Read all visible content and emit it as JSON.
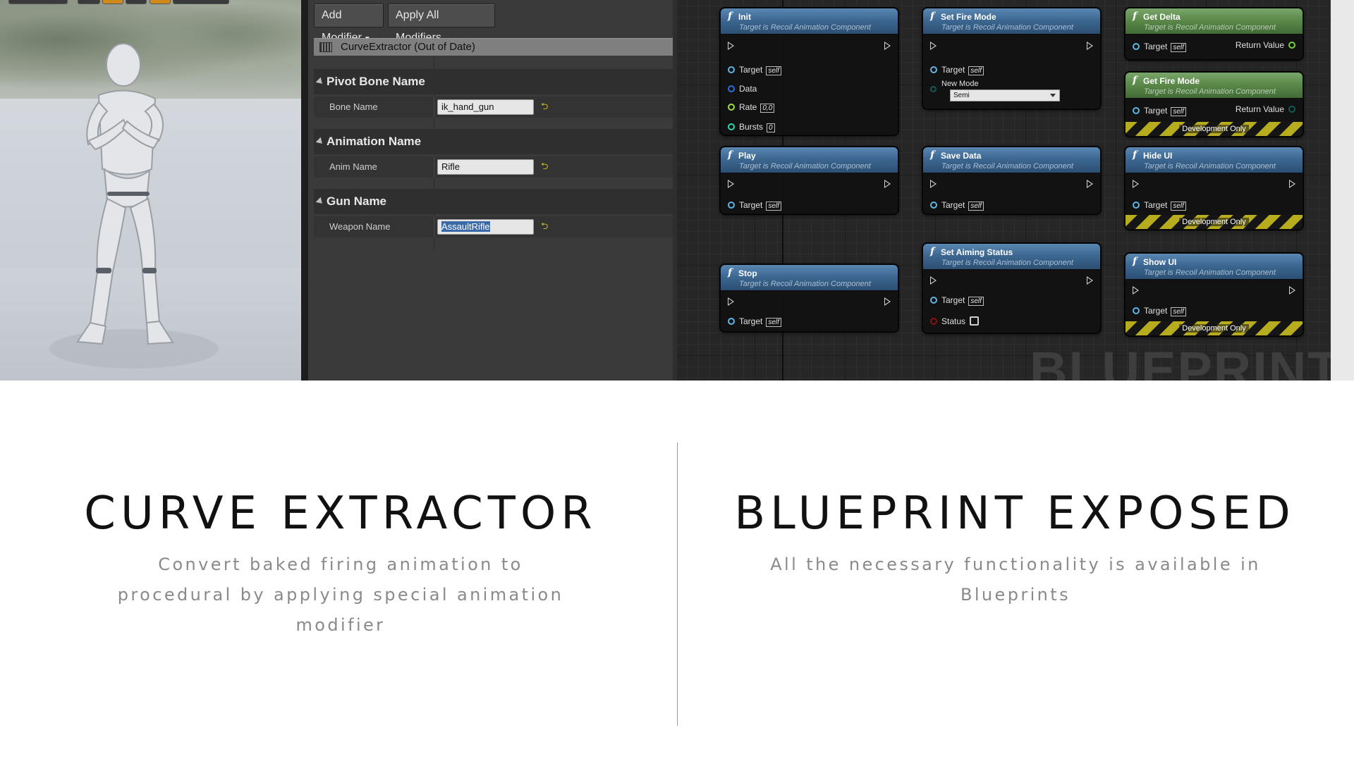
{
  "details": {
    "add_modifier_label": "Add Modifier",
    "apply_all_label": "Apply All Modifiers",
    "modifier_header": "CurveExtractor (Out of Date)",
    "categories": [
      {
        "title": "Pivot Bone Name",
        "prop_label": "Bone Name",
        "value": "ik_hand_gun"
      },
      {
        "title": "Animation Name",
        "prop_label": "Anim Name",
        "value": "Rifle"
      },
      {
        "title": "Gun Name",
        "prop_label": "Weapon Name",
        "value": "AssaultRifle"
      }
    ]
  },
  "graph": {
    "watermark": "BLUEPRINT",
    "target_subtitle": "Target is Recoil Animation Component",
    "self_label": "self",
    "target_label": "Target",
    "development_only": "Development Only",
    "nodes": {
      "init": {
        "title": "Init",
        "pins": {
          "data": "Data",
          "rate": "Rate",
          "rate_default": "0,0",
          "bursts": "Bursts",
          "bursts_default": "0"
        }
      },
      "set_fire_mode": {
        "title": "Set Fire Mode",
        "new_mode_label": "New Mode",
        "new_mode_value": "Semi"
      },
      "get_delta": {
        "title": "Get Delta",
        "return_label": "Return Value"
      },
      "get_fire_mode": {
        "title": "Get Fire Mode",
        "return_label": "Return Value"
      },
      "play": {
        "title": "Play"
      },
      "save_data": {
        "title": "Save Data"
      },
      "hide_ui": {
        "title": "Hide UI"
      },
      "set_aiming_status": {
        "title": "Set Aiming Status",
        "status_label": "Status"
      },
      "stop": {
        "title": "Stop"
      },
      "show_ui": {
        "title": "Show UI"
      }
    }
  },
  "sections": {
    "curve_extractor": {
      "heading": "CURVE EXTRACTOR",
      "lines": [
        "Convert baked firing animation to",
        "procedural by applying special animation",
        "modifier"
      ]
    },
    "blueprint_exposed": {
      "heading": "BLUEPRINT EXPOSED",
      "lines": [
        "All the necessary functionality is available in",
        "Blueprints"
      ]
    }
  }
}
